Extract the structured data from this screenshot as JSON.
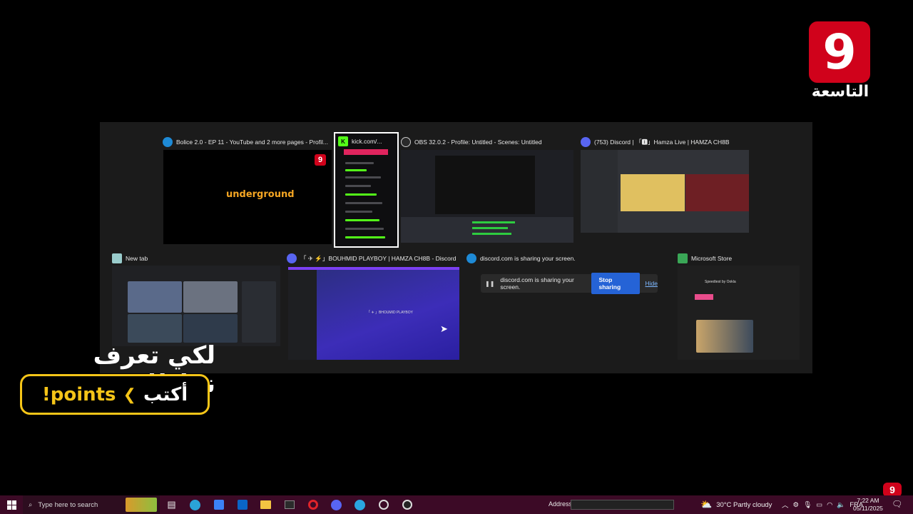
{
  "channel_logo": {
    "number": "9",
    "name": "التاسعة"
  },
  "windows": [
    {
      "title": "Bolice 2.0 - EP 11 - YouTube and 2 more pages - Profil...",
      "icon": "edge-icon",
      "inner_logo": "underground"
    },
    {
      "title": "kick.com/...",
      "icon": "kick-icon",
      "icon_letter": "K"
    },
    {
      "title": "OBS 32.0.2 - Profile: Untitled - Scenes: Untitled",
      "icon": "obs-icon"
    },
    {
      "title": "(753) Discord | 「🅸」Hamza Live | HAMZA CH8B",
      "icon": "discord-icon",
      "badge": "753"
    },
    {
      "title": "New tab",
      "icon": "edge-icon"
    },
    {
      "title": "「 ✈ ⚡」BOUHMID PLAYBOY | HAMZA CH8B - Discord",
      "icon": "discord-icon",
      "inner_text": "「 ✈ 」BHOUMID PLAYBOY"
    },
    {
      "title": "discord.com is sharing your screen.",
      "icon": "edge-icon"
    },
    {
      "title": "Microsoft Store",
      "icon": "store-icon",
      "inner_text": "Speedtest by Ookla"
    }
  ],
  "share_bar": {
    "message": "discord.com is sharing your screen.",
    "stop_label": "Stop sharing",
    "hide_label": "Hide"
  },
  "overlay": {
    "title": "لكي تعرف نقاطك :",
    "write": "أكتب",
    "command": "!points"
  },
  "taskbar": {
    "search_placeholder": "Type here to search",
    "address_label": "Address",
    "weather": "30°C  Partly cloudy",
    "language": "FRA",
    "time": "7:22 AM",
    "date": "05/11/2025"
  }
}
